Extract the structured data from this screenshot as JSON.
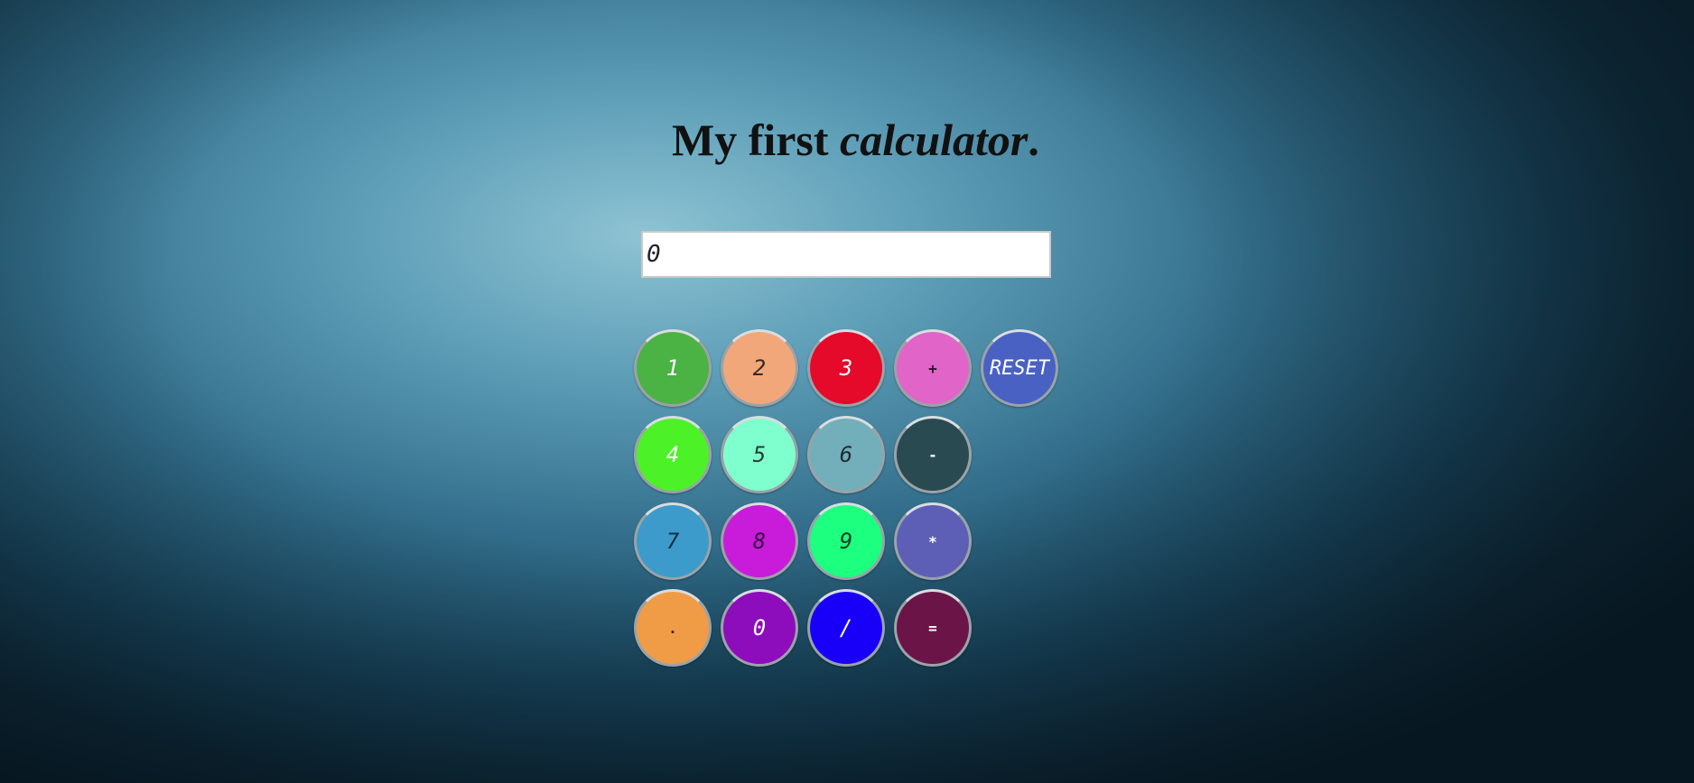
{
  "heading": {
    "part1": "My first ",
    "part2": "calculator",
    "part3": "."
  },
  "display": {
    "value": "0"
  },
  "buttons": [
    {
      "label": "1",
      "name": "digit-1-button",
      "bg": "#4bb244",
      "fg": "#ffffff"
    },
    {
      "label": "2",
      "name": "digit-2-button",
      "bg": "#f2a77b",
      "fg": "#3a2a20"
    },
    {
      "label": "3",
      "name": "digit-3-button",
      "bg": "#e5092a",
      "fg": "#ffffff"
    },
    {
      "label": "+",
      "name": "plus-button",
      "bg": "#e164c8",
      "fg": "#2a1226"
    },
    {
      "label": "RESET",
      "name": "reset-button",
      "bg": "#4a61c4",
      "fg": "#ffffff"
    },
    {
      "label": "4",
      "name": "digit-4-button",
      "bg": "#4cf227",
      "fg": "#ffffff"
    },
    {
      "label": "5",
      "name": "digit-5-button",
      "bg": "#80ffce",
      "fg": "#1e3d33"
    },
    {
      "label": "6",
      "name": "digit-6-button",
      "bg": "#73aebb",
      "fg": "#1a2a30"
    },
    {
      "label": "-",
      "name": "minus-button",
      "bg": "#2a4a52",
      "fg": "#ffffff"
    },
    {
      "label": "7",
      "name": "digit-7-button",
      "bg": "#3c9bcb",
      "fg": "#12303f"
    },
    {
      "label": "8",
      "name": "digit-8-button",
      "bg": "#c81cda",
      "fg": "#3a0c40"
    },
    {
      "label": "9",
      "name": "digit-9-button",
      "bg": "#1cff7f",
      "fg": "#0c3a20"
    },
    {
      "label": "*",
      "name": "multiply-button",
      "bg": "#5d5fb6",
      "fg": "#ffffff"
    },
    {
      "label": ".",
      "name": "decimal-button",
      "bg": "#f09c46",
      "fg": "#3a2410"
    },
    {
      "label": "0",
      "name": "digit-0-button",
      "bg": "#8d0cbb",
      "fg": "#ffffff"
    },
    {
      "label": "/",
      "name": "divide-button",
      "bg": "#1800f8",
      "fg": "#ffffff"
    },
    {
      "label": "=",
      "name": "equals-button",
      "bg": "#6b1448",
      "fg": "#ffffff"
    }
  ]
}
